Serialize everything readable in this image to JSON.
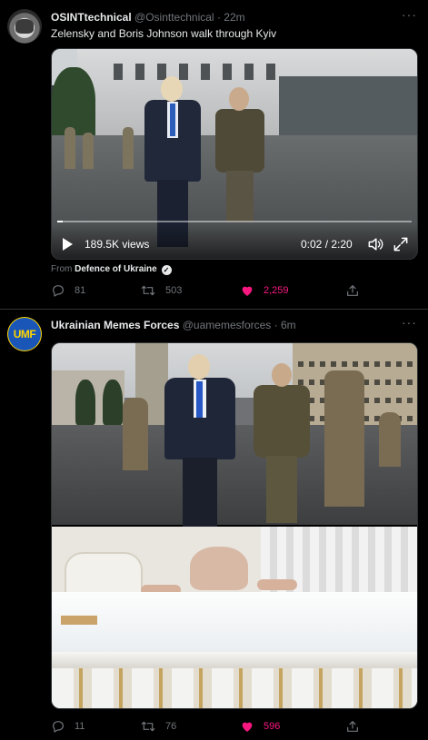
{
  "tweet1": {
    "author_name": "OSINTtechnical",
    "handle": "@Osinttechnical",
    "separator": "·",
    "time": "22m",
    "more": "···",
    "text": "Zelensky and Boris Johnson walk through Kyiv",
    "video": {
      "views": "189.5K views",
      "time": "0:02 / 2:20",
      "progress_fraction": 0.015
    },
    "from_prefix": "From",
    "from_source": "Defence of Ukraine",
    "actions": {
      "replies": "81",
      "retweets": "503",
      "likes": "2,259"
    }
  },
  "tweet2": {
    "author_name": "Ukrainian Memes Forces",
    "avatar_text": "UMF",
    "handle": "@uamemesforces",
    "separator": "·",
    "time": "6m",
    "more": "···",
    "actions": {
      "replies": "11",
      "retweets": "76",
      "likes": "596"
    }
  },
  "colors": {
    "background": "#000000",
    "text": "#e7e9ea",
    "muted": "#71767b",
    "like_active": "#f91880",
    "divider": "#2f3336"
  },
  "icons": [
    "verified-icon",
    "play-icon",
    "volume-icon",
    "expand-icon",
    "reply-icon",
    "retweet-icon",
    "heart-icon",
    "share-icon",
    "more-icon"
  ]
}
